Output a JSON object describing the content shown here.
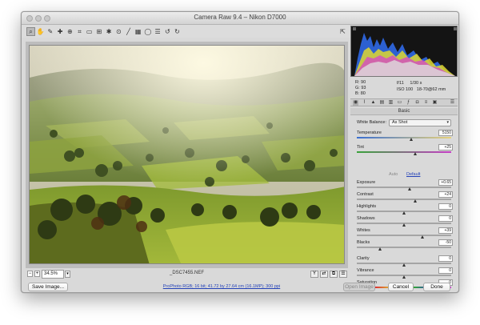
{
  "window": {
    "title": "Camera Raw 9.4  –  Nikon D7000"
  },
  "toolbar": {
    "tools": [
      {
        "name": "zoom-tool-icon",
        "glyph": "⌕",
        "active": true
      },
      {
        "name": "hand-tool-icon",
        "glyph": "✋",
        "active": false
      },
      {
        "name": "white-balance-tool-icon",
        "glyph": "✎",
        "active": false
      },
      {
        "name": "color-sampler-tool-icon",
        "glyph": "✚",
        "active": false
      },
      {
        "name": "targeted-adjustment-tool-icon",
        "glyph": "⊕",
        "active": false
      },
      {
        "name": "crop-tool-icon",
        "glyph": "⌗",
        "active": false
      },
      {
        "name": "straighten-tool-icon",
        "glyph": "▭",
        "active": false
      },
      {
        "name": "transform-tool-icon",
        "glyph": "⊞",
        "active": false
      },
      {
        "name": "spot-removal-tool-icon",
        "glyph": "✱",
        "active": false
      },
      {
        "name": "red-eye-tool-icon",
        "glyph": "⊙",
        "active": false
      },
      {
        "name": "adjustment-brush-icon",
        "glyph": "╱",
        "active": false
      },
      {
        "name": "graduated-filter-icon",
        "glyph": "▦",
        "active": false
      },
      {
        "name": "radial-filter-icon",
        "glyph": "◯",
        "active": false
      },
      {
        "name": "preferences-icon",
        "glyph": "☰",
        "active": false
      },
      {
        "name": "rotate-left-icon",
        "glyph": "↺",
        "active": false
      },
      {
        "name": "rotate-right-icon",
        "glyph": "↻",
        "active": false
      }
    ],
    "fullscreen_glyph": "⇱"
  },
  "preview": {
    "zoom": "34.5%",
    "filename": "_DSC7455.NEF"
  },
  "camera_info": {
    "r_label": "R:",
    "r_value": "90",
    "g_label": "G:",
    "g_value": "93",
    "b_label": "B:",
    "b_value": "80",
    "aperture": "f/11",
    "shutter": "1/30 s",
    "iso": "ISO 100",
    "lens": "18-70@62 mm"
  },
  "panel": {
    "section_title": "Basic"
  },
  "basic": {
    "white_balance_label": "White Balance:",
    "white_balance_value": "As Shot",
    "temperature": {
      "label": "Temperature",
      "value": "5150",
      "pos": 0.58
    },
    "tint": {
      "label": "Tint",
      "value": "+25",
      "pos": 0.62
    },
    "auto_label": "Auto",
    "default_label": "Default",
    "exposure": {
      "label": "Exposure",
      "value": "+0.65",
      "pos": 0.56
    },
    "contrast": {
      "label": "Contrast",
      "value": "+24",
      "pos": 0.62
    },
    "highlights": {
      "label": "Highlights",
      "value": "0",
      "pos": 0.5
    },
    "shadows": {
      "label": "Shadows",
      "value": "0",
      "pos": 0.5
    },
    "whites": {
      "label": "Whites",
      "value": "+39",
      "pos": 0.7
    },
    "blacks": {
      "label": "Blacks",
      "value": "-50",
      "pos": 0.25
    },
    "clarity": {
      "label": "Clarity",
      "value": "0",
      "pos": 0.5
    },
    "vibrance": {
      "label": "Vibrance",
      "value": "0",
      "pos": 0.5
    },
    "saturation": {
      "label": "Saturation",
      "value": "0",
      "pos": 0.5
    }
  },
  "bottom": {
    "save_label": "Save Image...",
    "workflow_label": "ProPhoto RGB; 16 bit; 41.72 by 27.64 cm (16.1MP); 300 ppi",
    "open_label": "Open Image",
    "cancel_label": "Cancel",
    "done_label": "Done"
  }
}
